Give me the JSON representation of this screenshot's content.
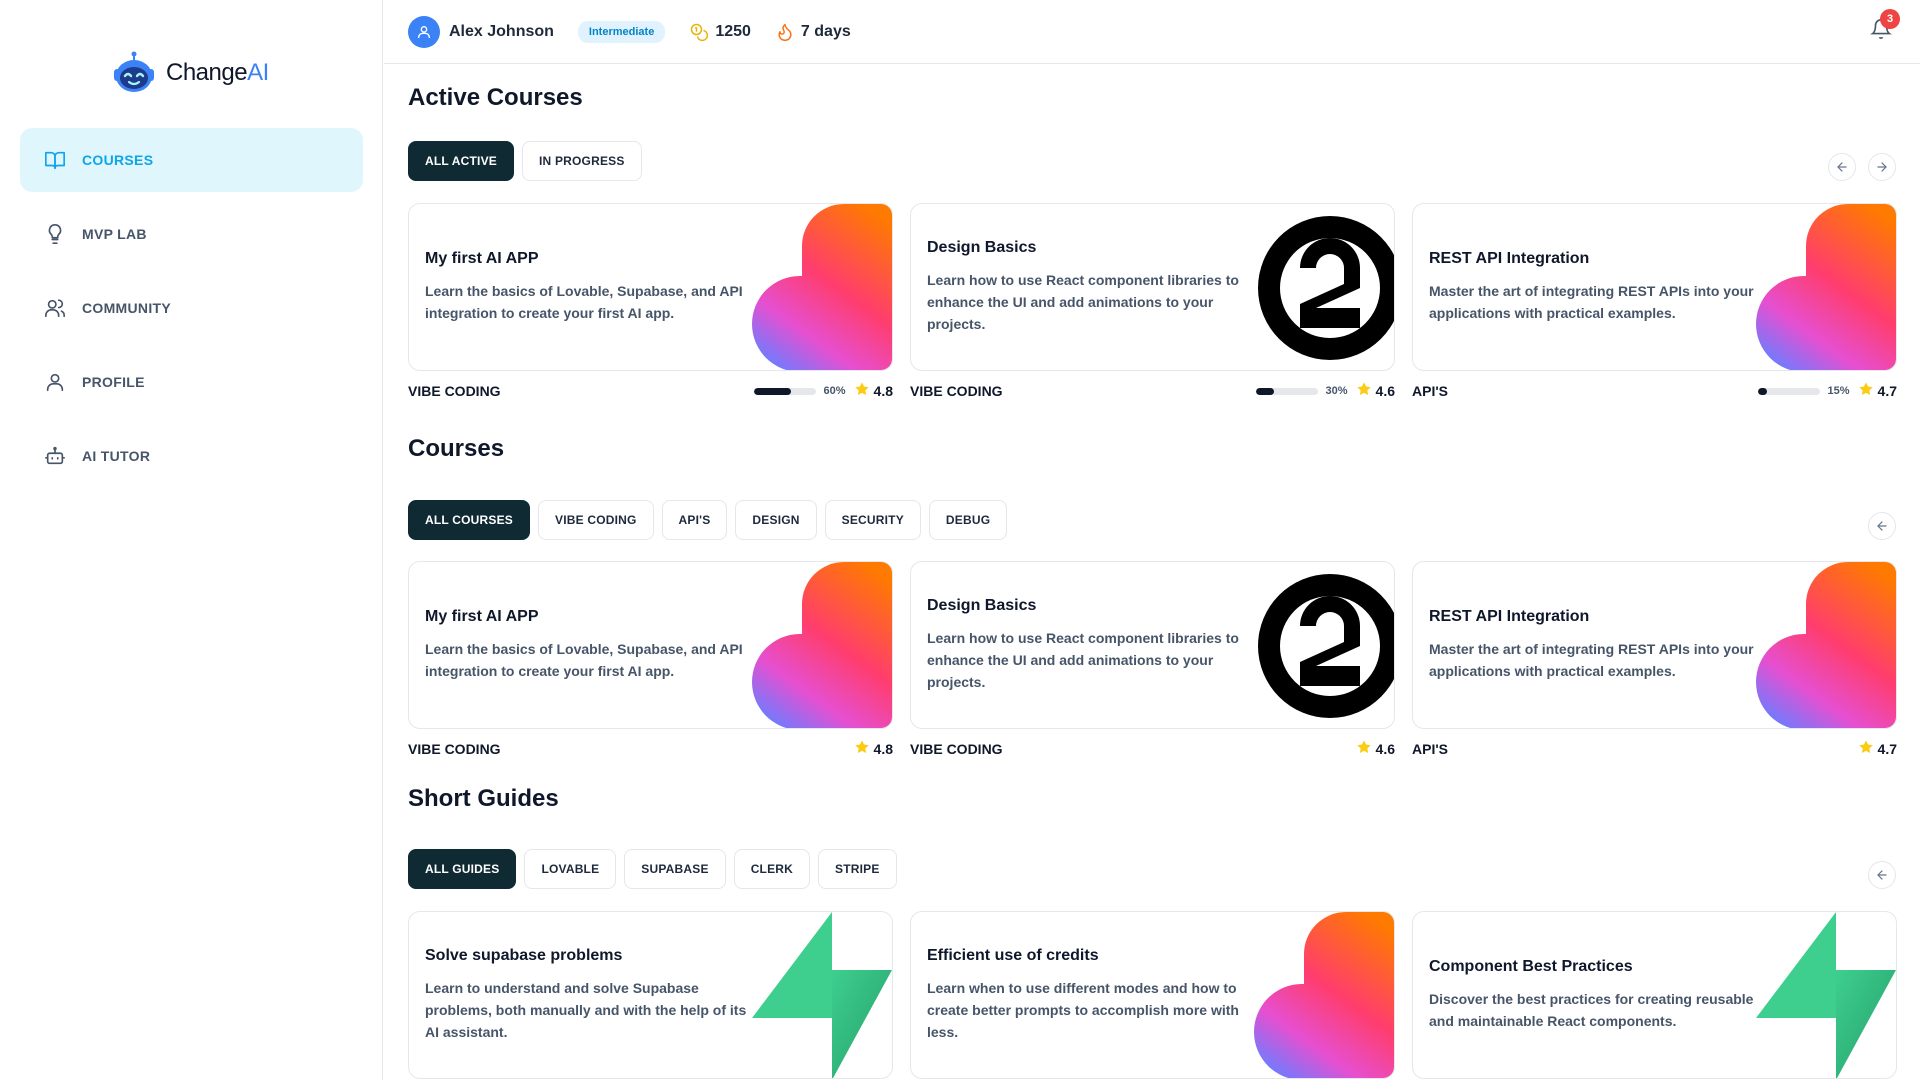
{
  "brand": {
    "name_main": "Change",
    "name_accent": "AI",
    "accent_color": "#3b82f6"
  },
  "sidebar": {
    "items": [
      {
        "label": "COURSES",
        "icon": "book-open-icon",
        "active": true
      },
      {
        "label": "MVP LAB",
        "icon": "lightbulb-icon",
        "active": false
      },
      {
        "label": "COMMUNITY",
        "icon": "users-icon",
        "active": false
      },
      {
        "label": "PROFILE",
        "icon": "user-icon",
        "active": false
      },
      {
        "label": "AI TUTOR",
        "icon": "bot-icon",
        "active": false
      }
    ]
  },
  "header": {
    "user_name": "Alex Johnson",
    "level": "Intermediate",
    "coins": "1250",
    "streak": "7 days",
    "notifications": "3"
  },
  "active_courses": {
    "title": "Active Courses",
    "filters": [
      "ALL ACTIVE",
      "IN PROGRESS"
    ],
    "cards": [
      {
        "title": "My first AI APP",
        "description": "Learn the basics of Lovable, Supabase, and API integration to create your first AI app.",
        "category": "VIBE CODING",
        "progress": 60,
        "progress_label": "60%",
        "rating": "4.8",
        "art": "lovable-heart-icon"
      },
      {
        "title": "Design Basics",
        "description": "Learn how to use React component libraries to enhance the UI and add animations to your projects.",
        "category": "VIBE CODING",
        "progress": 30,
        "progress_label": "30%",
        "rating": "4.6",
        "art": "circle-logo-icon"
      },
      {
        "title": "REST API Integration",
        "description": "Master the art of integrating REST APIs into your applications with practical examples.",
        "category": "API'S",
        "progress": 15,
        "progress_label": "15%",
        "rating": "4.7",
        "art": "lovable-heart-icon"
      }
    ]
  },
  "courses": {
    "title": "Courses",
    "filters": [
      "ALL COURSES",
      "VIBE CODING",
      "API'S",
      "DESIGN",
      "SECURITY",
      "DEBUG"
    ],
    "cards": [
      {
        "title": "My first AI APP",
        "description": "Learn the basics of Lovable, Supabase, and API integration to create your first AI app.",
        "category": "VIBE CODING",
        "rating": "4.8",
        "art": "lovable-heart-icon"
      },
      {
        "title": "Design Basics",
        "description": "Learn how to use React component libraries to enhance the UI and add animations to your projects.",
        "category": "VIBE CODING",
        "rating": "4.6",
        "art": "circle-logo-icon"
      },
      {
        "title": "REST API Integration",
        "description": "Master the art of integrating REST APIs into your applications with practical examples.",
        "category": "API'S",
        "rating": "4.7",
        "art": "lovable-heart-icon"
      }
    ]
  },
  "guides": {
    "title": "Short Guides",
    "filters": [
      "ALL GUIDES",
      "LOVABLE",
      "SUPABASE",
      "CLERK",
      "STRIPE"
    ],
    "cards": [
      {
        "title": "Solve supabase problems",
        "description": "Learn to understand and solve Supabase problems, both manually and with the help of its AI assistant.",
        "art": "supabase-bolt-icon"
      },
      {
        "title": "Efficient use of credits",
        "description": "Learn when to use different modes and how to create better prompts to accomplish more with less.",
        "art": "lovable-heart-icon"
      },
      {
        "title": "Component Best Practices",
        "description": "Discover the best practices for creating reusable and maintainable React components.",
        "art": "supabase-bolt-icon"
      }
    ]
  }
}
